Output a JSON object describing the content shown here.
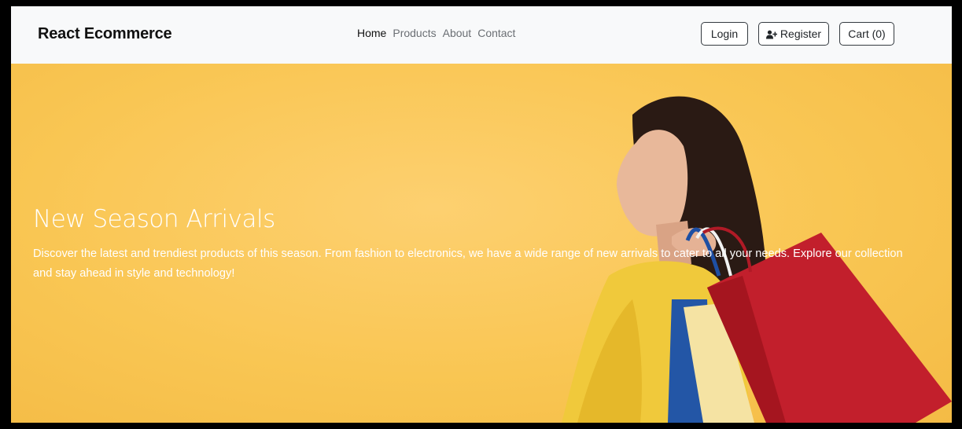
{
  "navbar": {
    "brand": "React Ecommerce",
    "links": [
      {
        "label": "Home",
        "active": true
      },
      {
        "label": "Products",
        "active": false
      },
      {
        "label": "About",
        "active": false
      },
      {
        "label": "Contact",
        "active": false
      }
    ],
    "login_label": "Login",
    "register_label": "Register",
    "cart_label": "Cart (0)",
    "register_icon": "user-plus-icon"
  },
  "hero": {
    "title": "New Season Arrivals",
    "description": "Discover the latest and trendiest products of this season. From fashion to electronics, we have a wide range of new arrivals to cater to all your needs. Explore our collection and stay ahead in style and technology!",
    "background_color": "#f9c653"
  }
}
